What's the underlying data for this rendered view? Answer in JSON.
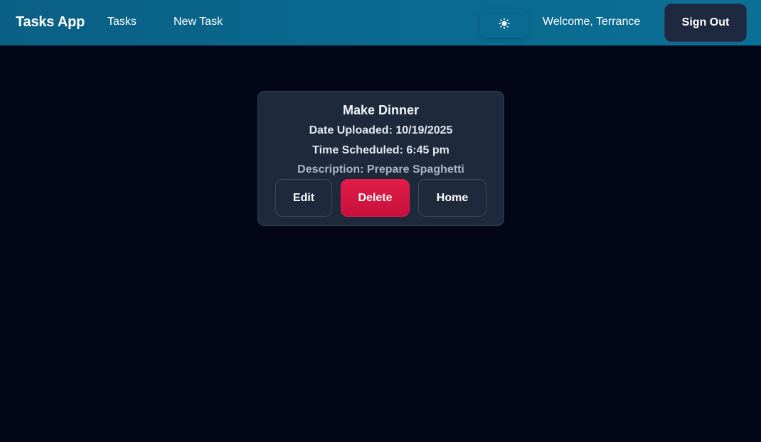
{
  "navbar": {
    "brand": "Tasks App",
    "links": [
      {
        "label": "Tasks"
      },
      {
        "label": "New Task"
      }
    ],
    "theme_toggle_icon": "sun-icon",
    "welcome_text": "Welcome, Terrance",
    "sign_out_label": "Sign Out"
  },
  "task": {
    "title": "Make Dinner",
    "date_uploaded": "Date Uploaded: 10/19/2025",
    "time_scheduled": "Time Scheduled: 6:45 pm",
    "description": "Description: Prepare Spaghetti"
  },
  "actions": {
    "edit_label": "Edit",
    "delete_label": "Delete",
    "home_label": "Home"
  },
  "colors": {
    "background": "#020617",
    "navbar": "#0a6990",
    "card": "#1e293b",
    "danger": "#e11d48"
  }
}
